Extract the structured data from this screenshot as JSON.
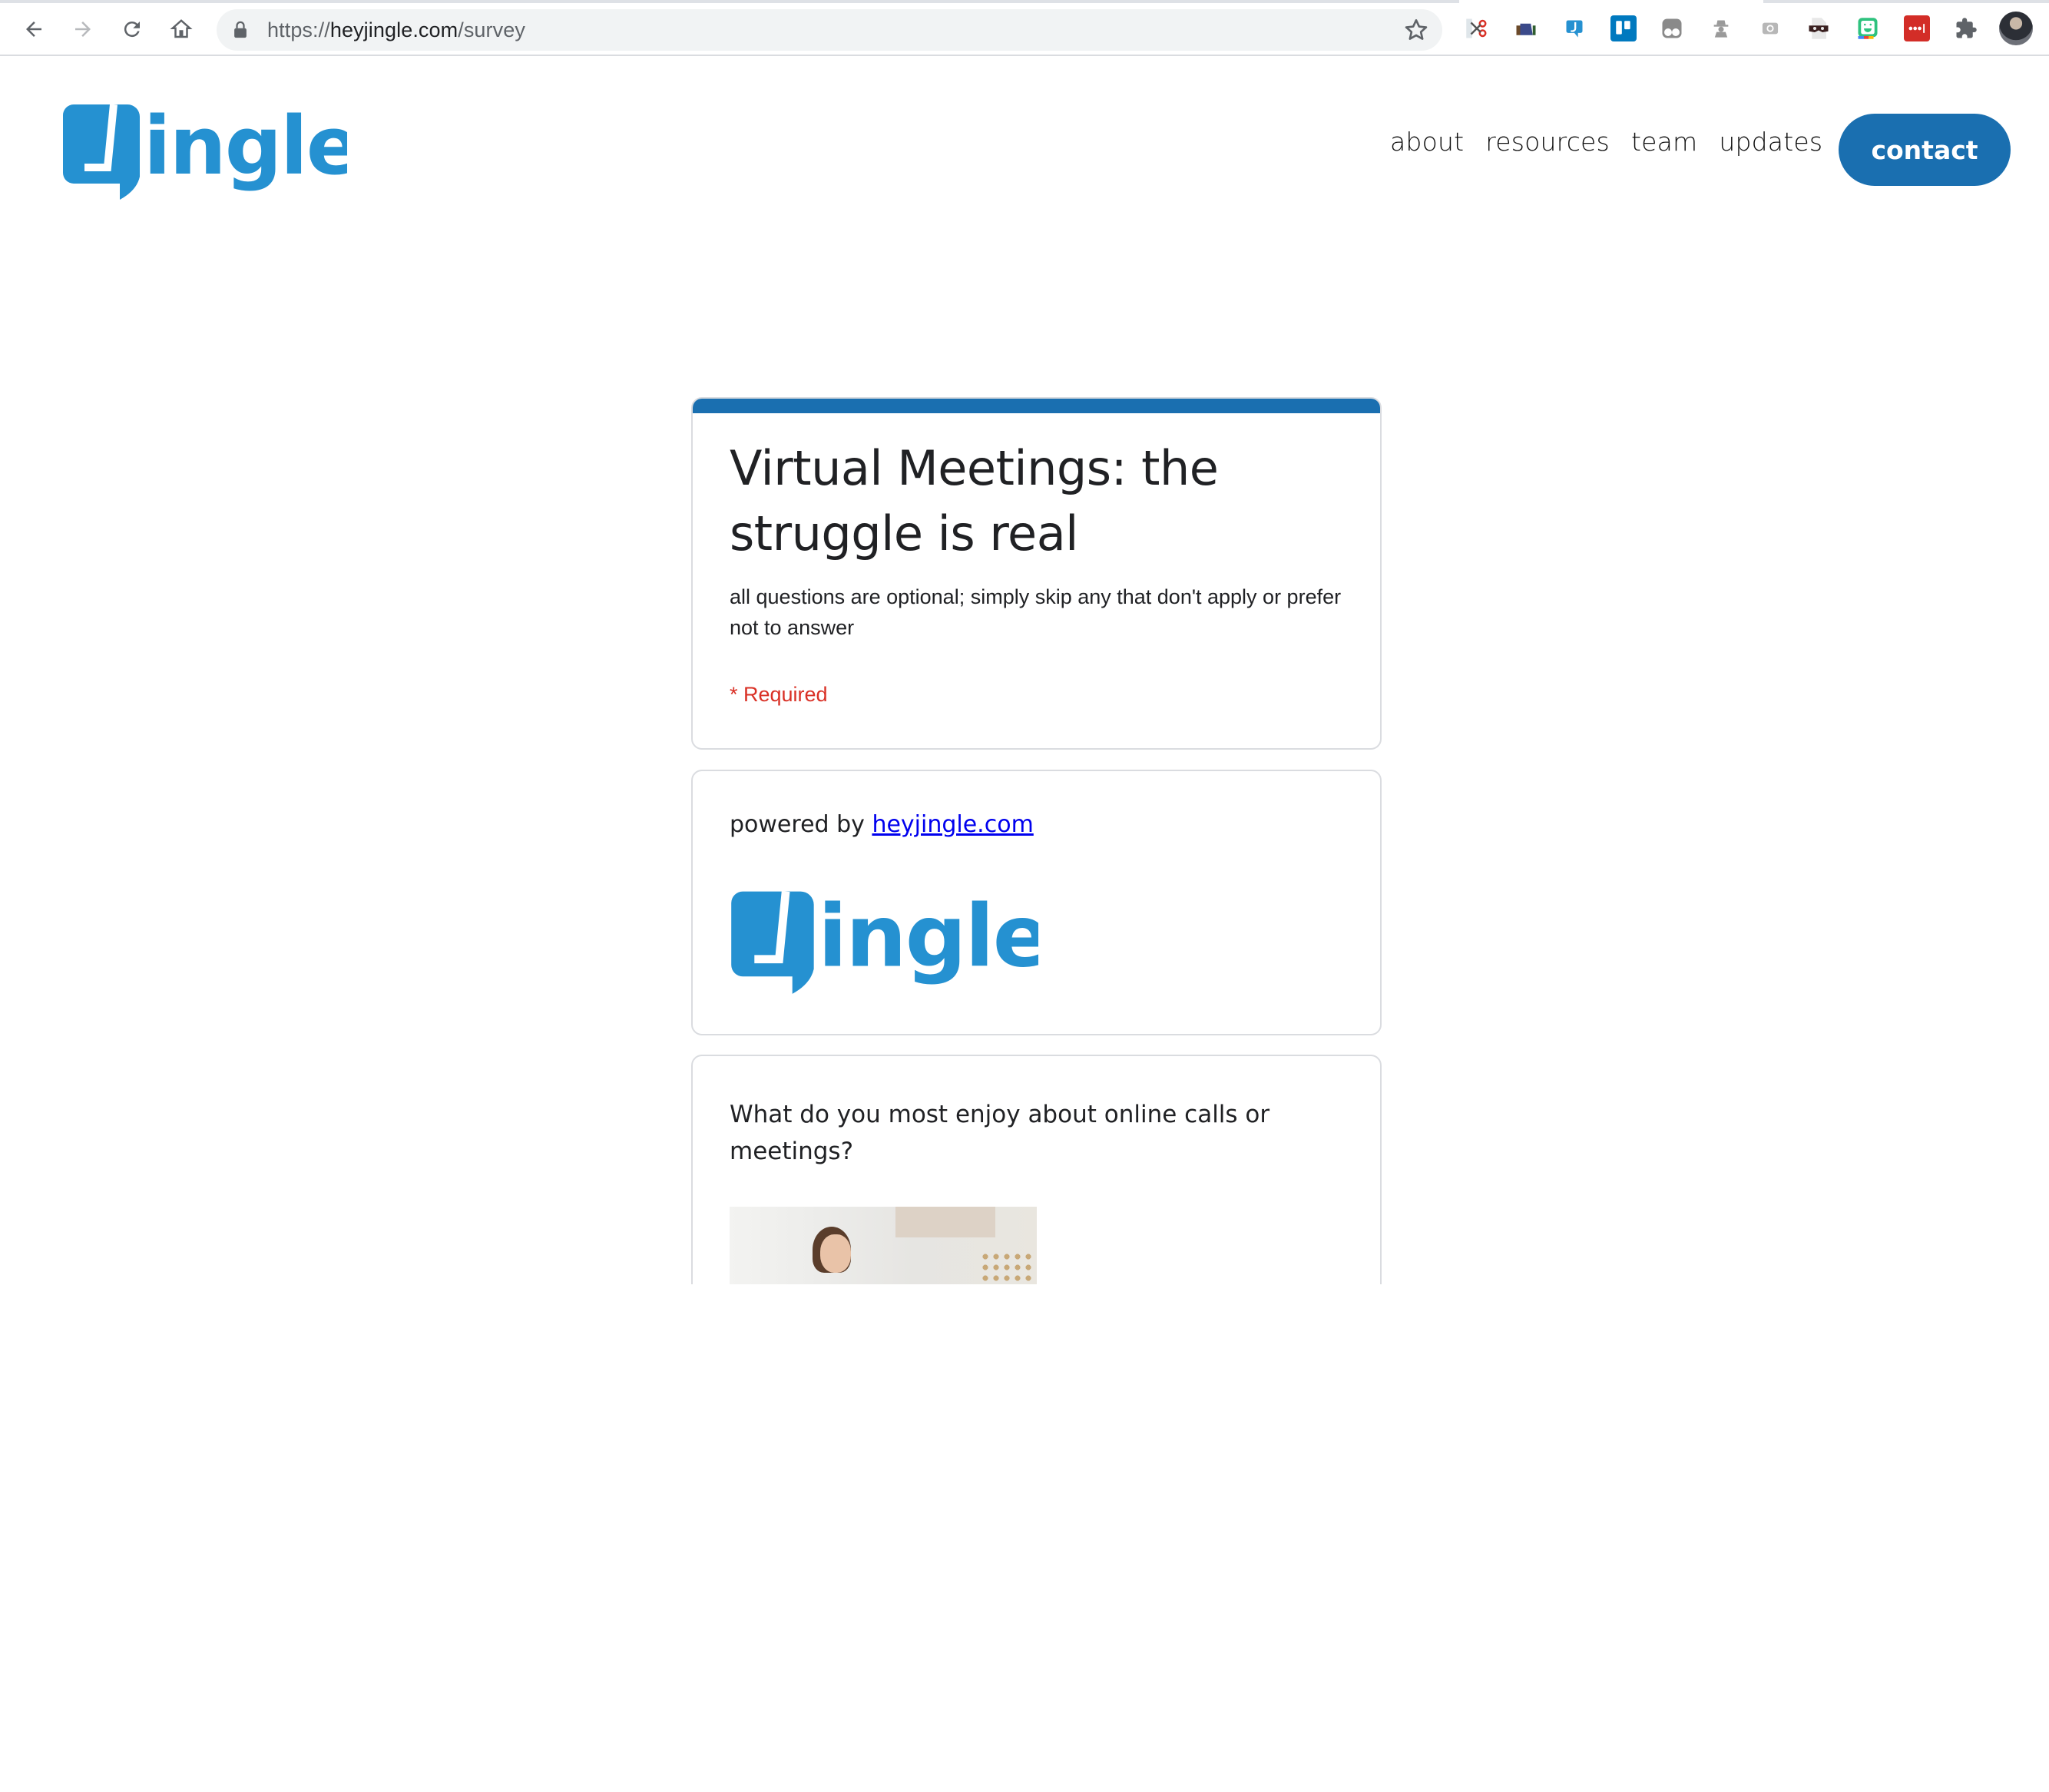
{
  "browser": {
    "url_scheme": "https://",
    "url_host": "heyjingle.com",
    "url_path": "/survey",
    "extensions": [
      {
        "name": "clipper-extension",
        "color": "#d93025"
      },
      {
        "name": "reader-extension",
        "color": "#3b4a8a"
      },
      {
        "name": "jingle-extension",
        "color": "#2591d1"
      },
      {
        "name": "trello-extension",
        "color": "#0079bf"
      },
      {
        "name": "tab-extension",
        "color": "#8a8a8a"
      },
      {
        "name": "incognito-extension",
        "color": "#9a9a9a"
      },
      {
        "name": "screen-capture-extension",
        "color": "#b0b0b0"
      },
      {
        "name": "mask-extension",
        "color": "#3a2a2a"
      },
      {
        "name": "bitmoji-extension",
        "color": "#2ec27e"
      },
      {
        "name": "lastpass-extension",
        "color": "#d32d27"
      }
    ]
  },
  "site": {
    "logo_text": "Jingle",
    "brand_color": "#2591d1",
    "nav": [
      "about",
      "resources",
      "team",
      "updates"
    ],
    "contact_label": "contact",
    "accent_color": "#1a6fb0"
  },
  "form": {
    "title": "Virtual Meetings: the struggle is real",
    "description": "all questions are optional; simply skip any that don't apply or prefer not to answer",
    "required_note": "* Required",
    "powered_prefix": "powered by ",
    "powered_link": "heyjingle.com",
    "powered_logo_text": "Jingle",
    "question_1": "What do you most enjoy about online calls or meetings?"
  }
}
